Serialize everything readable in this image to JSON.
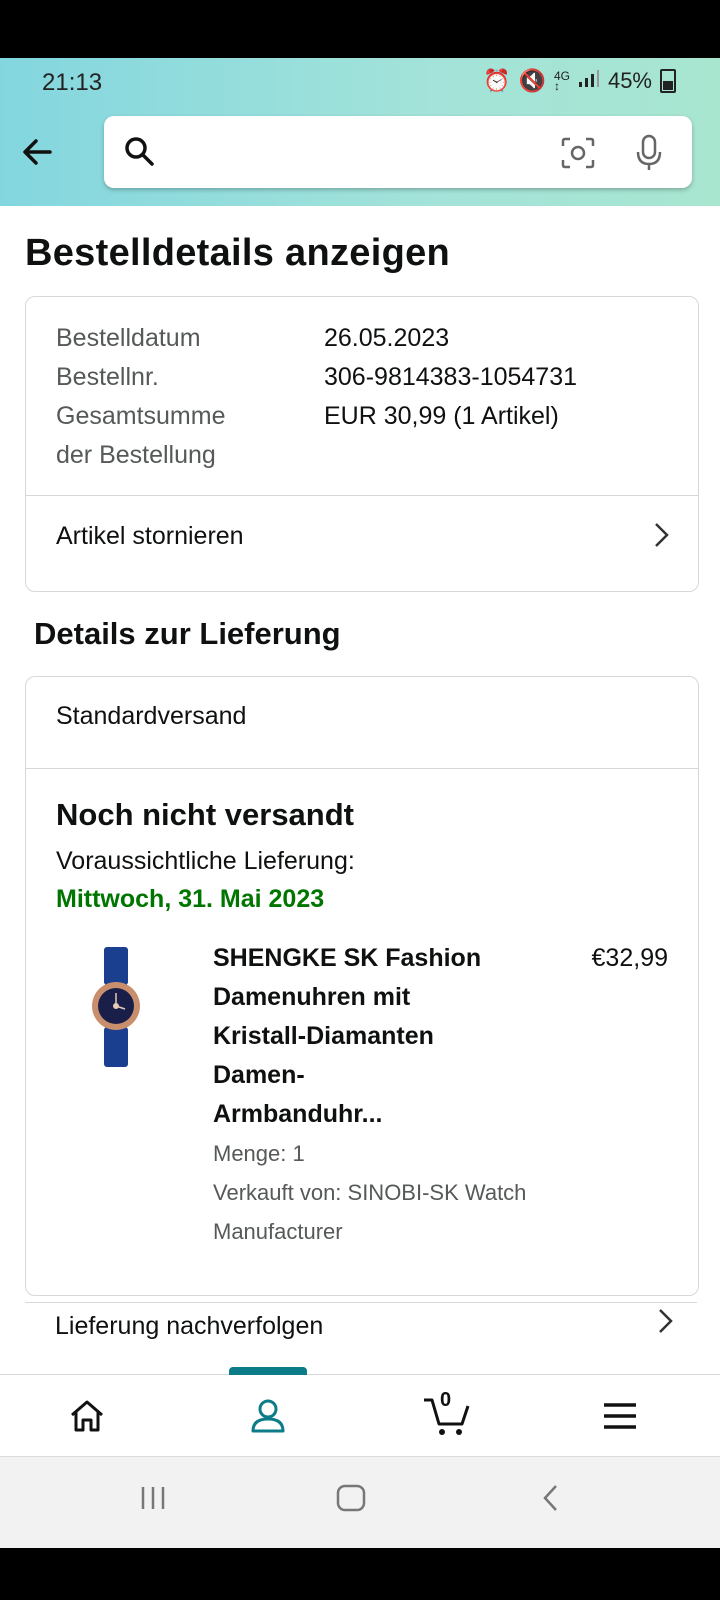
{
  "status_bar": {
    "time": "21:13",
    "icons": [
      "alarm-icon",
      "mute-icon",
      "network-4g-icon",
      "signal-icon"
    ],
    "battery": "45%"
  },
  "search": {
    "placeholder": ""
  },
  "page": {
    "title": "Bestelldetails anzeigen"
  },
  "order": {
    "labels": {
      "date": "Bestelldatum",
      "number": "Bestellnr.",
      "total_line1": "Gesamtsumme",
      "total_line2": "der Bestellung"
    },
    "date": "26.05.2023",
    "number": "306-9814383-1054731",
    "total": "EUR 30,99 (1 Artikel)",
    "cancel_label": "Artikel stornieren"
  },
  "delivery": {
    "heading": "Details zur Lieferung",
    "shipping_method": "Standardversand",
    "status": "Noch nicht versandt",
    "eta_label": "Voraussichtliche Lieferung:",
    "eta_date": "Mittwoch, 31. Mai 2023",
    "item": {
      "title_lines": [
        "SHENGKE SK Fashion",
        "Damenuhren mit",
        "Kristall-Diamanten",
        "Damen-",
        "Armbanduhr..."
      ],
      "price": "€32,99",
      "quantity": "Menge: 1",
      "seller_line1": "Verkauft von: SINOBI-SK Watch",
      "seller_line2": "Manufacturer"
    },
    "track_label": "Lieferung nachverfolgen"
  },
  "bottom_nav": {
    "cart_count": "0",
    "active": "account"
  },
  "colors": {
    "header_gradient_start": "#83d6df",
    "header_gradient_end": "#a8e6d0",
    "eta_green": "#007600",
    "accent_teal": "#0c7c88"
  }
}
